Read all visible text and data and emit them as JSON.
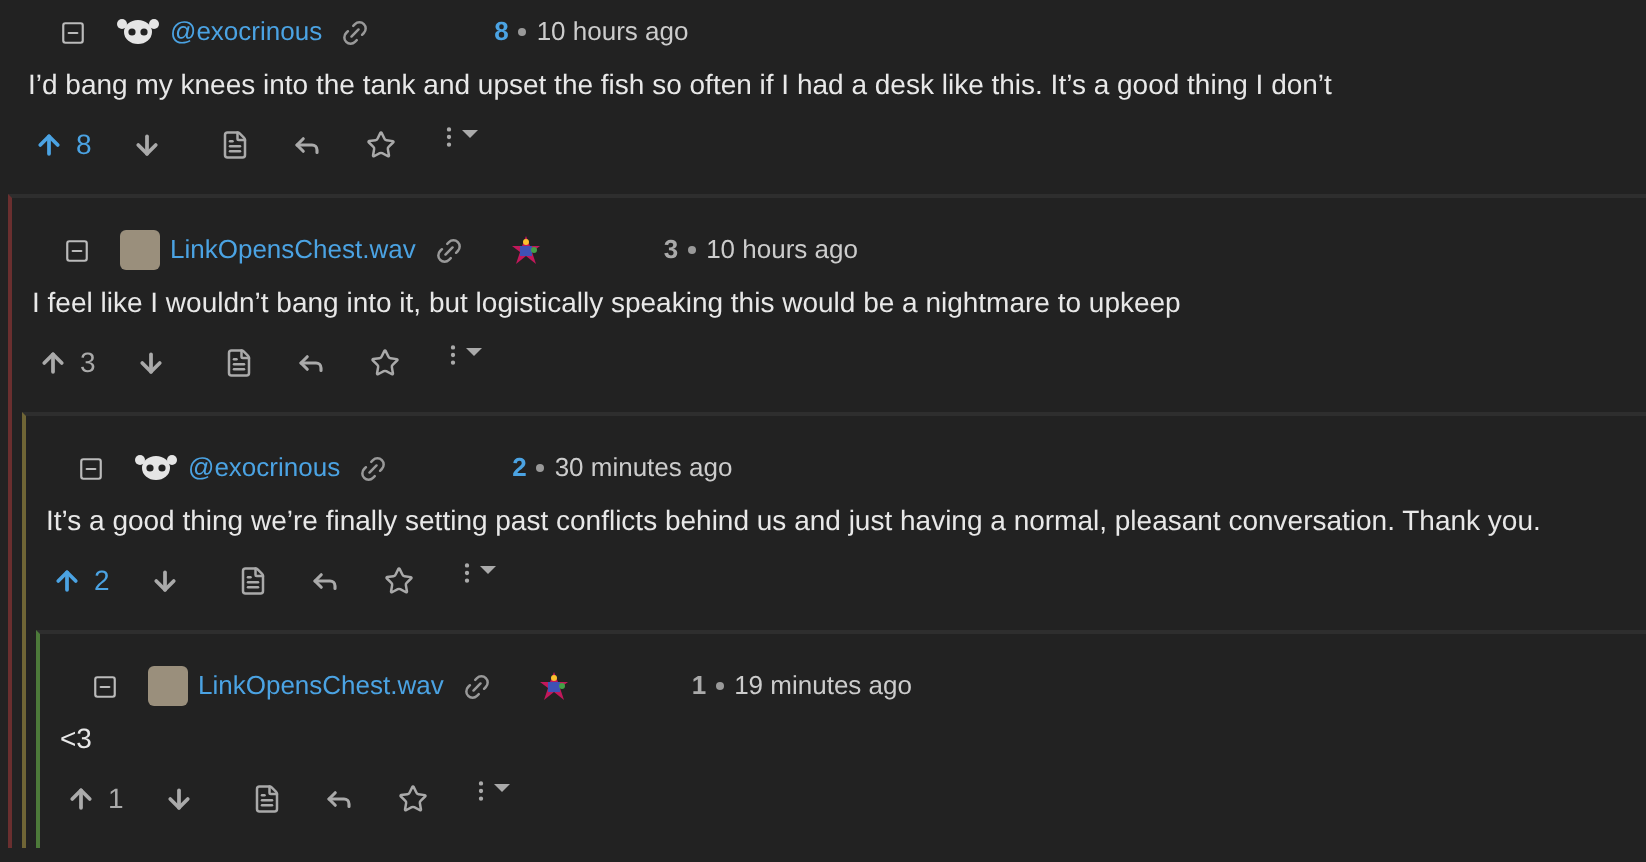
{
  "comments": [
    {
      "author": "@exocrinous",
      "avatar": {
        "kind": "skull"
      },
      "flair": false,
      "score": "8",
      "time": "10 hours ago",
      "body": "I’d bang my knees into the tank and upset the fish so often if I had a desk like this. It’s a good thing I don’t",
      "upvoted": true,
      "upvotes": "8",
      "children": [
        {
          "author": "LinkOpensChest.wav",
          "avatar": {
            "kind": "photo"
          },
          "flair": true,
          "score": "3",
          "time": "10 hours ago",
          "body": "I feel like I wouldn’t bang into it, but logistically speaking this would be a nightmare to upkeep",
          "upvoted": false,
          "upvotes": "3",
          "children": [
            {
              "author": "@exocrinous",
              "avatar": {
                "kind": "skull"
              },
              "flair": false,
              "score": "2",
              "time": "30 minutes ago",
              "body": "It’s a good thing we’re finally setting past conflicts behind us and just having a normal, pleasant conversation. Thank you.",
              "upvoted": true,
              "upvotes": "2",
              "children": [
                {
                  "author": "LinkOpensChest.wav",
                  "avatar": {
                    "kind": "photo"
                  },
                  "flair": true,
                  "score": "1",
                  "time": "19 minutes ago",
                  "body": "<3",
                  "upvoted": false,
                  "upvotes": "1"
                }
              ]
            }
          ]
        }
      ]
    }
  ]
}
